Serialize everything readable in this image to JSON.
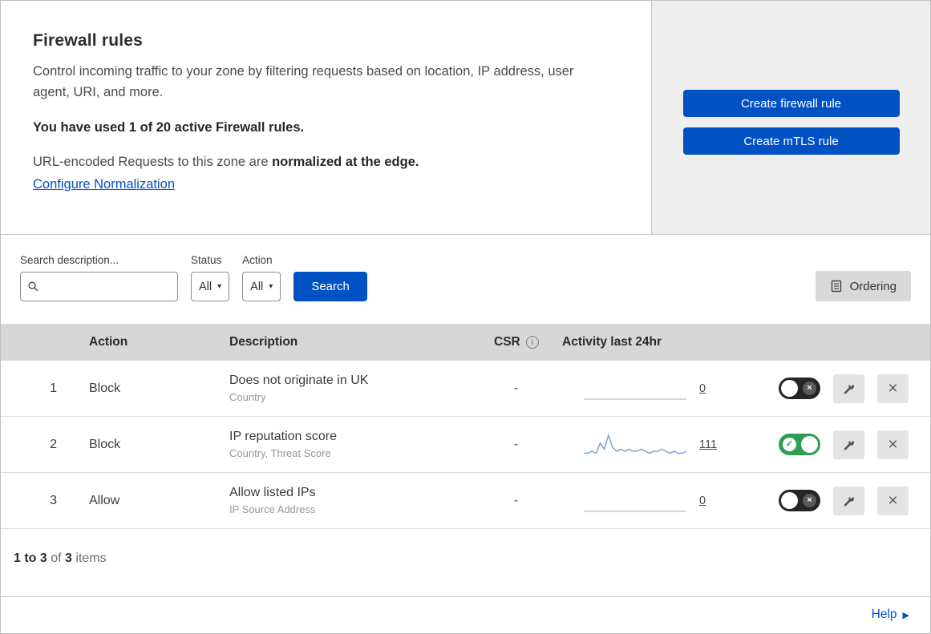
{
  "colors": {
    "accent_blue": "#0051c3",
    "toggle_on_green": "#2e9e55",
    "toggle_off_dark": "#262626",
    "table_header_bg": "#d7d7d7",
    "panel_gray": "#efefef",
    "sparkline_blue": "#74a7d8"
  },
  "header": {
    "title": "Firewall rules",
    "description": "Control incoming traffic to your zone by filtering requests based on location, IP address, user agent, URI, and more.",
    "usage_note": "You have used 1 of 20 active Firewall rules.",
    "normalization_prefix": "URL-encoded Requests to this zone are ",
    "normalization_bold": "normalized at the edge.",
    "normalization_link": "Configure Normalization",
    "create_firewall_button": "Create firewall rule",
    "create_mtls_button": "Create mTLS rule"
  },
  "filters": {
    "search_label": "Search description...",
    "search_value": "",
    "status_label": "Status",
    "status_value": "All",
    "action_label": "Action",
    "action_value": "All",
    "search_button": "Search",
    "ordering_button": "Ordering"
  },
  "table": {
    "headers": {
      "action": "Action",
      "description": "Description",
      "csr": "CSR",
      "activity": "Activity last 24hr"
    },
    "rows": [
      {
        "number": "1",
        "action": "Block",
        "description": "Does not originate in UK",
        "criteria": "Country",
        "csr": "-",
        "activity_count": "0",
        "enabled": false,
        "sparkline": []
      },
      {
        "number": "2",
        "action": "Block",
        "description": "IP reputation score",
        "criteria": "Country, Threat Score",
        "csr": "-",
        "activity_count": "111",
        "enabled": true,
        "sparkline": [
          1,
          1,
          2,
          1,
          6,
          3,
          10,
          4,
          2,
          3,
          2,
          3,
          2,
          2,
          3,
          2,
          1,
          2,
          2,
          3,
          2,
          1,
          2,
          1,
          1,
          2
        ]
      },
      {
        "number": "3",
        "action": "Allow",
        "description": "Allow listed IPs",
        "criteria": "IP Source Address",
        "csr": "-",
        "activity_count": "0",
        "enabled": false,
        "sparkline": []
      }
    ]
  },
  "icons": {
    "caret": "▾",
    "info": "i",
    "check": "✓",
    "cross": "×",
    "close": "×",
    "help_arrow": "▶"
  },
  "footer": {
    "range": "1 to 3",
    "of": " of ",
    "total": "3",
    "items": " items",
    "help": "Help"
  }
}
